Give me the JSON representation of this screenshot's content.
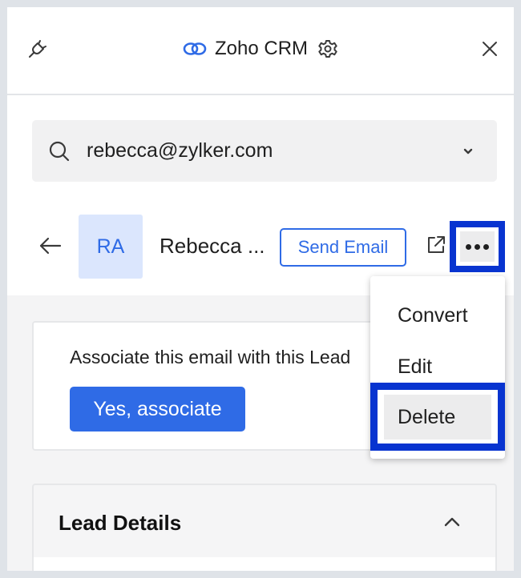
{
  "header": {
    "title": "Zoho CRM",
    "icons": {
      "left": "plug-icon",
      "logo": "zoho-logo-icon",
      "settings": "gear-icon",
      "close": "close-icon"
    }
  },
  "search": {
    "value": "rebecca@zylker.com",
    "icon": "search-icon",
    "dropdown_icon": "chevron-down-icon"
  },
  "contact": {
    "initials": "RA",
    "name": "Rebecca ...",
    "send_email_label": "Send Email",
    "icons": {
      "back": "back-arrow-icon",
      "open": "external-link-icon",
      "more": "more-icon"
    }
  },
  "associate": {
    "text": "Associate this email with this Lead",
    "button_label": "Yes, associate"
  },
  "lead_details": {
    "title": "Lead Details",
    "icon": "chevron-up-icon"
  },
  "menu": {
    "items": [
      {
        "label": "Convert"
      },
      {
        "label": "Edit"
      },
      {
        "label": "Delete"
      }
    ]
  },
  "colors": {
    "accent": "#2f6be6",
    "highlight": "#0834d0",
    "avatar_bg": "#dbe6fd"
  }
}
